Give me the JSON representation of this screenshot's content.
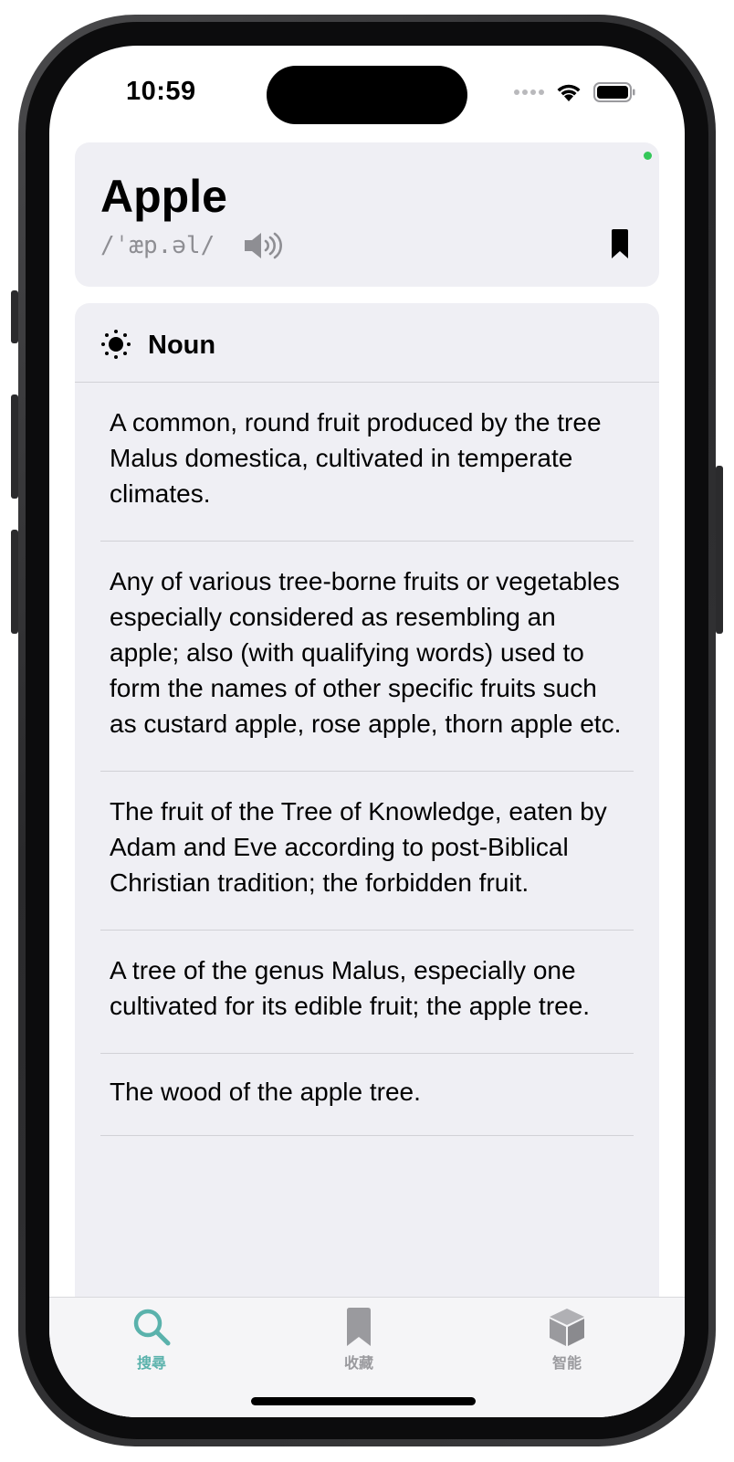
{
  "status_bar": {
    "time": "10:59"
  },
  "entry": {
    "word": "Apple",
    "phonetic": "/ˈæp.əl/",
    "speaker_icon": "speaker-wave-icon",
    "bookmark_icon": "bookmark-icon"
  },
  "meaning": {
    "part_of_speech": "Noun",
    "pos_icon": "sun-icon",
    "definitions": [
      "A common, round fruit produced by the tree Malus domestica, cultivated in temperate climates.",
      "Any of various tree-borne fruits or vegetables especially considered as resembling an apple; also (with qualifying words) used to form the names of other specific fruits such as custard apple, rose apple, thorn apple etc.",
      "The fruit of the Tree of Knowledge, eaten by Adam and Eve according to post-Biblical Christian tradition; the forbidden fruit.",
      "A tree of the genus Malus, especially one cultivated for its edible fruit; the apple tree.",
      "The wood of the apple tree."
    ]
  },
  "tabbar": {
    "tabs": [
      {
        "label": "搜尋",
        "icon": "search-icon",
        "active": true
      },
      {
        "label": "收藏",
        "icon": "bookmark-icon",
        "active": false
      },
      {
        "label": "智能",
        "icon": "cube-icon",
        "active": false
      }
    ]
  },
  "colors": {
    "accent": "#5ab2ac",
    "inactive": "#9a9a9e",
    "card_bg": "#efeff4",
    "status_green": "#34c759"
  }
}
